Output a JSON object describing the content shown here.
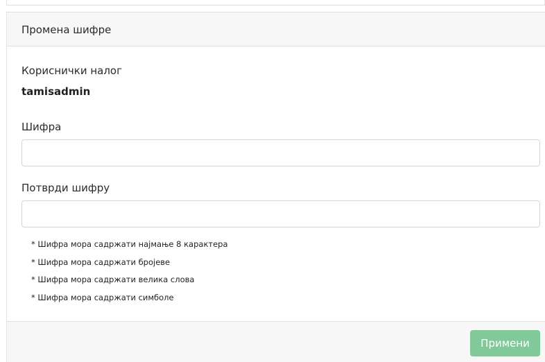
{
  "panel": {
    "title": "Промена шифре"
  },
  "account": {
    "label": "Кориснички налог",
    "username": "tamisadmin"
  },
  "password": {
    "label": "Шифра",
    "value": "",
    "placeholder": ""
  },
  "confirm_password": {
    "label": "Потврди шифру",
    "value": "",
    "placeholder": ""
  },
  "requirements": [
    "* Шифра мора садржати најмање 8 карактера",
    "* Шифра мора садржати бројеве",
    "* Шифра мора садржати велика слова",
    "* Шифра мора садржати симболе"
  ],
  "footer": {
    "apply_label": "Примени"
  },
  "colors": {
    "header_bg": "#f7f7f7",
    "apply_button": "#82c99a",
    "border": "#dfdfdf"
  }
}
